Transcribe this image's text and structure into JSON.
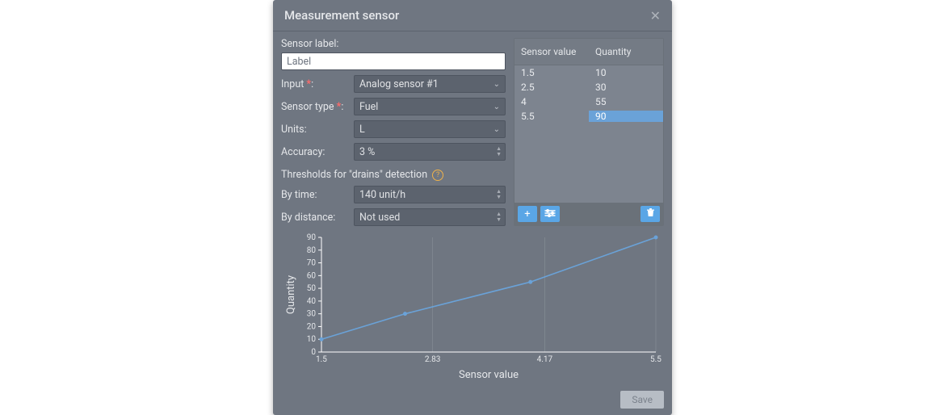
{
  "dialog": {
    "title": "Measurement sensor"
  },
  "form": {
    "sensor_label_caption": "Sensor label:",
    "sensor_label_value": "Label",
    "input_caption": "Input",
    "input_value": "Analog sensor #1",
    "sensor_type_caption": "Sensor type",
    "sensor_type_value": "Fuel",
    "units_caption": "Units:",
    "units_value": "L",
    "accuracy_caption": "Accuracy:",
    "accuracy_value": "3  %",
    "thresholds_caption": "Thresholds for \"drains\" detection",
    "by_time_caption": "By time:",
    "by_time_value": "140 unit/h",
    "by_distance_caption": "By distance:",
    "by_distance_value": "Not used",
    "required_mark": "*",
    "colon": ":"
  },
  "table": {
    "col1": "Sensor value",
    "col2": "Quantity",
    "rows": [
      {
        "sv": "1.5",
        "q": "10",
        "selected": false
      },
      {
        "sv": "2.5",
        "q": "30",
        "selected": false
      },
      {
        "sv": "4",
        "q": "55",
        "selected": false
      },
      {
        "sv": "5.5",
        "q": "90",
        "selected": true
      }
    ]
  },
  "icons": {
    "chevron_down": "⌄",
    "spin_up": "▲",
    "spin_down": "▼",
    "help": "?",
    "close": "✕",
    "plus": "+",
    "settings": "≡",
    "trash": "🗑"
  },
  "chart_data": {
    "type": "line",
    "title": "",
    "xlabel": "Sensor value",
    "ylabel": "Quantity",
    "xlim": [
      1.5,
      5.5
    ],
    "ylim": [
      0,
      90
    ],
    "x_ticks": [
      1.5,
      2.83,
      4.17,
      5.5
    ],
    "y_ticks": [
      0,
      10,
      20,
      30,
      40,
      50,
      60,
      70,
      80,
      90
    ],
    "series": [
      {
        "name": "Quantity",
        "x": [
          1.5,
          2.5,
          4,
          5.5
        ],
        "y": [
          10,
          30,
          55,
          90
        ]
      }
    ]
  },
  "footer": {
    "save_label": "Save"
  }
}
